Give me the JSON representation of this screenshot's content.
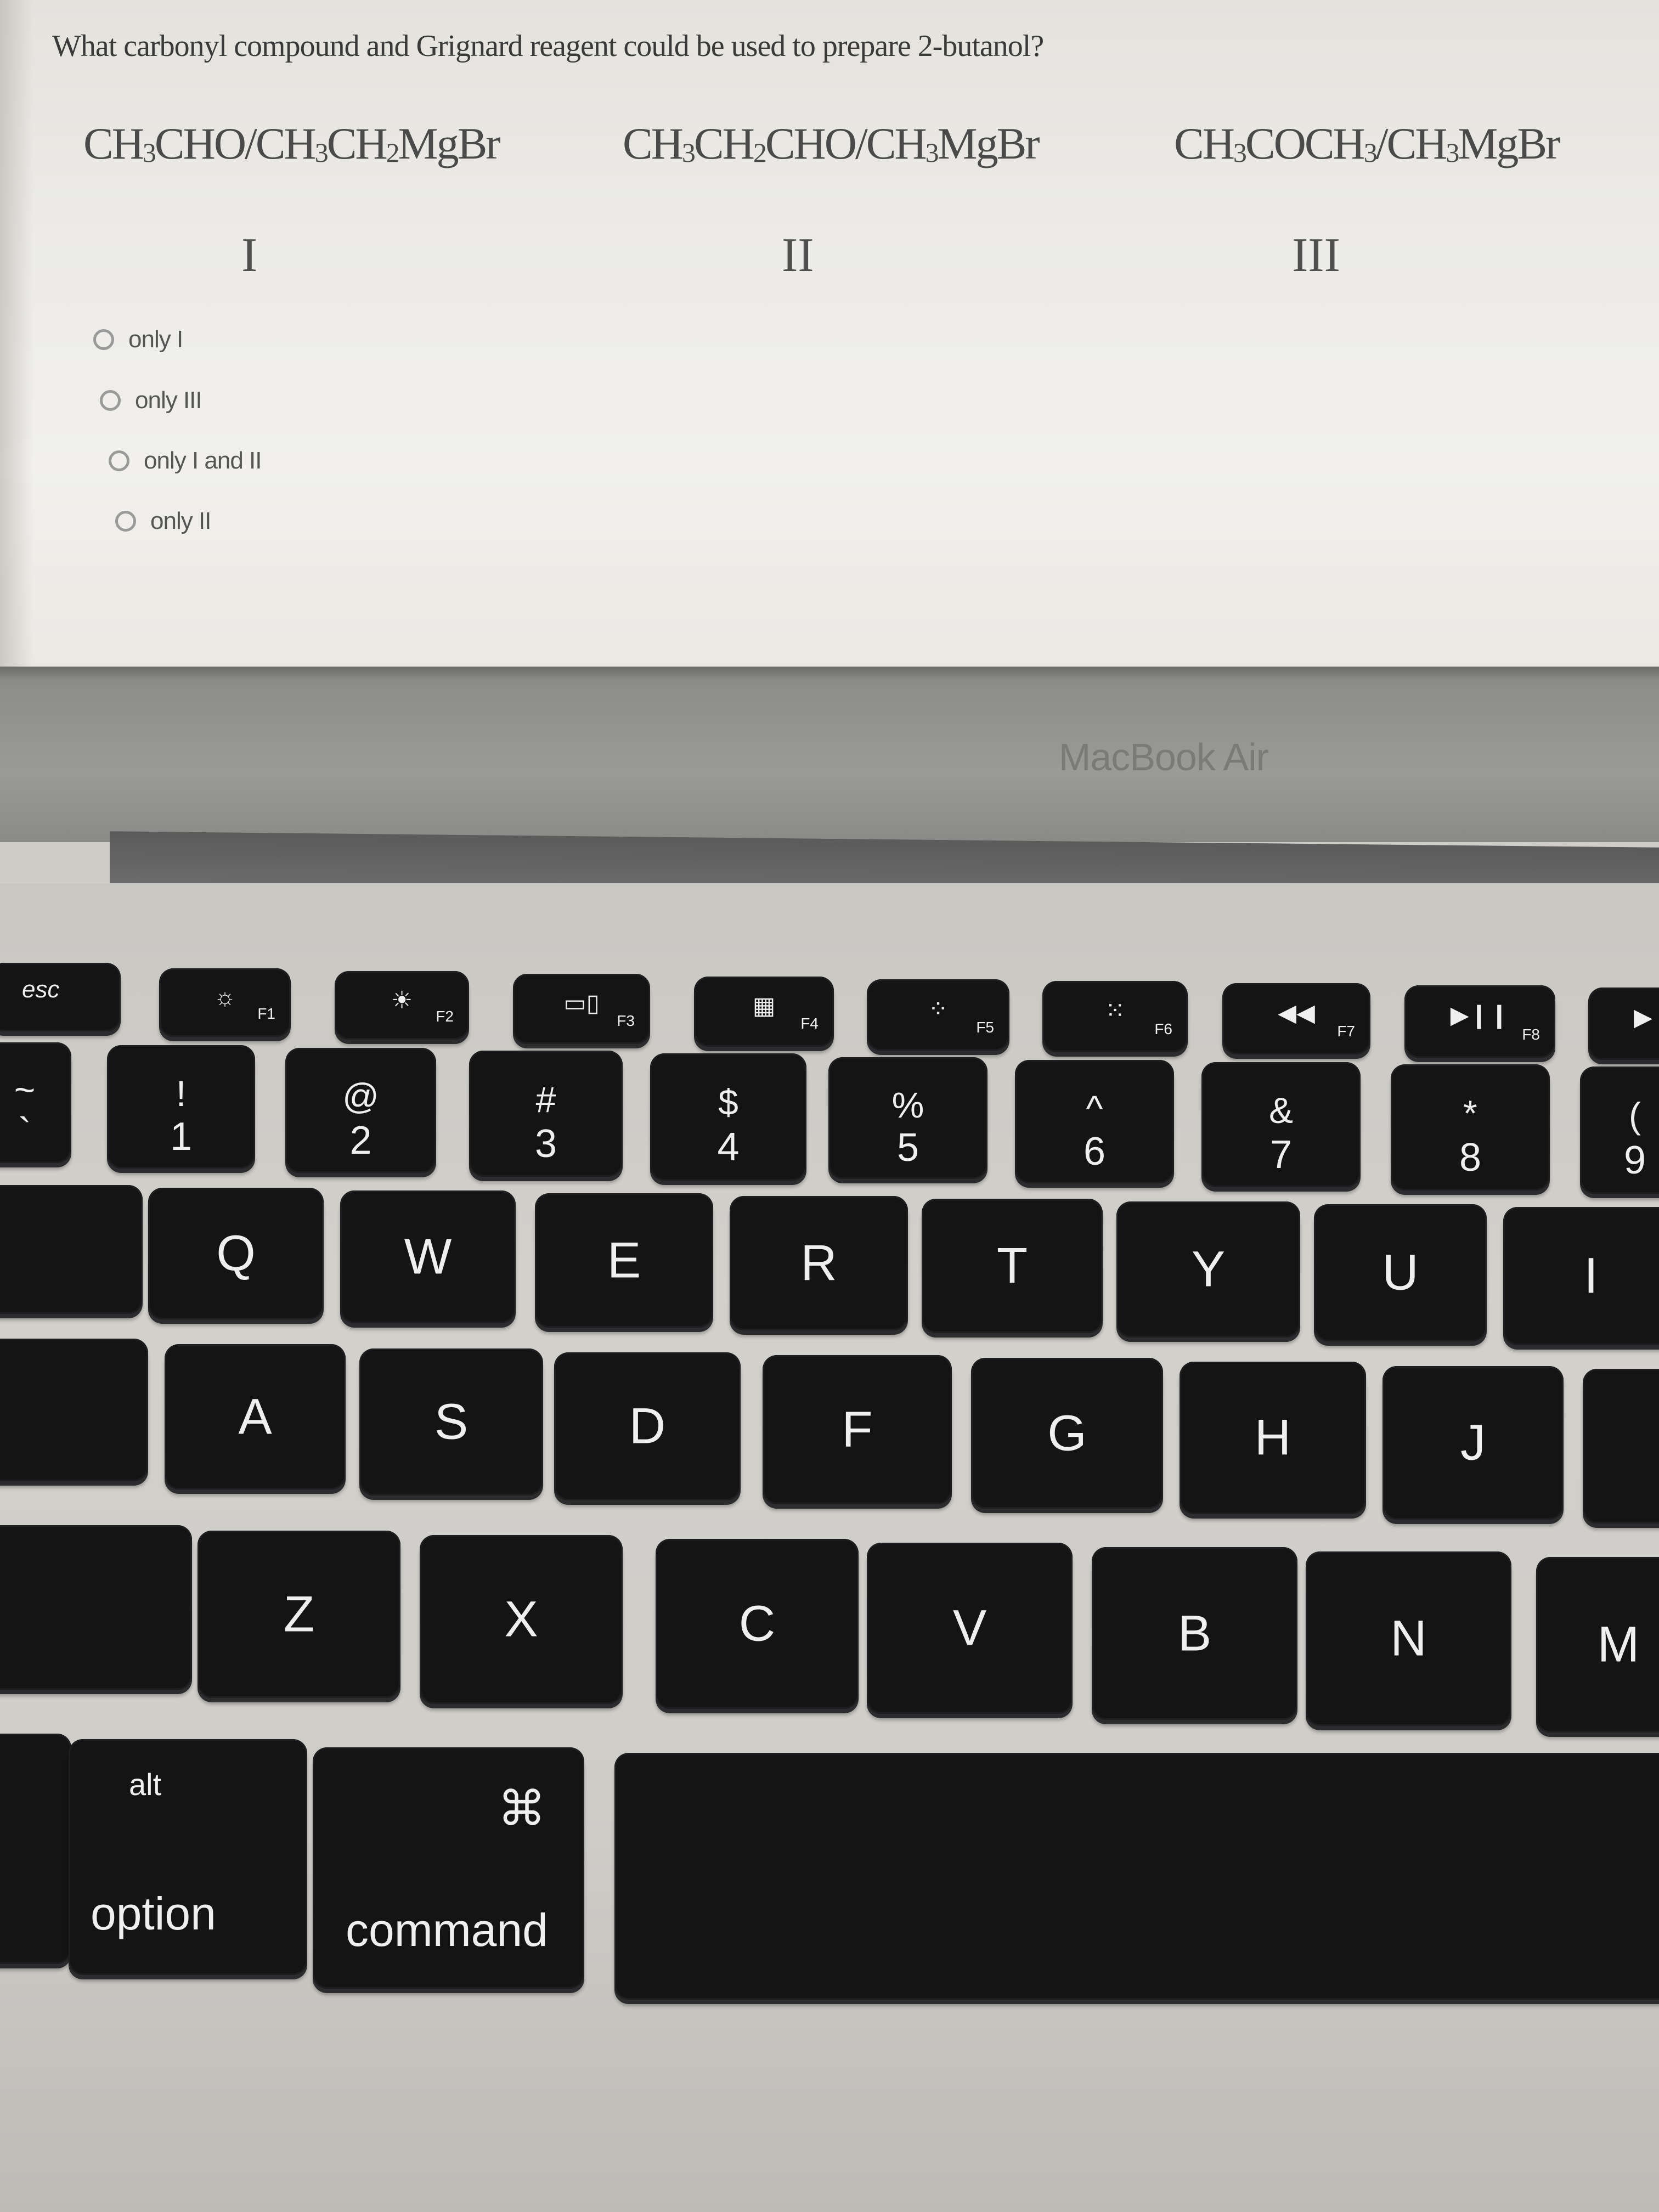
{
  "screen": {
    "question": "What carbonyl compound and Grignard reagent could be used to prepare 2-butanol?",
    "choices": [
      {
        "numeral": "I",
        "formula_parts": [
          "CH",
          "3",
          "CHO/CH",
          "3",
          "CH",
          "2",
          "MgBr"
        ]
      },
      {
        "numeral": "II",
        "formula_parts": [
          "CH",
          "3",
          "CH",
          "2",
          "CHO/CH",
          "3",
          "MgBr"
        ]
      },
      {
        "numeral": "III",
        "formula_parts": [
          "CH",
          "3",
          "COCH",
          "3",
          "/CH",
          "3",
          "MgBr"
        ]
      }
    ],
    "options": [
      {
        "label": "only I",
        "selected": false
      },
      {
        "label": "only III",
        "selected": false
      },
      {
        "label": "only I and II",
        "selected": false
      },
      {
        "label": "only II",
        "selected": false
      }
    ]
  },
  "device": {
    "brand": "MacBook Air"
  },
  "keyboard": {
    "function_row": [
      {
        "glyph": "",
        "fn": "",
        "label": "esc",
        "icon": "escape"
      },
      {
        "glyph": "☼",
        "fn": "F1",
        "icon": "brightness-down-icon"
      },
      {
        "glyph": "☀",
        "fn": "F2",
        "icon": "brightness-up-icon"
      },
      {
        "glyph": "▭▯",
        "fn": "F3",
        "icon": "mission-control-icon"
      },
      {
        "glyph": "▦",
        "fn": "F4",
        "icon": "launchpad-icon"
      },
      {
        "glyph": "⁘",
        "fn": "F5",
        "icon": "keyboard-light-down-icon"
      },
      {
        "glyph": "⁙",
        "fn": "F6",
        "icon": "keyboard-light-up-icon"
      },
      {
        "glyph": "◀◀",
        "fn": "F7",
        "icon": "rewind-icon"
      },
      {
        "glyph": "▶❙❙",
        "fn": "F8",
        "icon": "play-pause-icon"
      },
      {
        "glyph": "▶",
        "fn": "",
        "icon": "fast-forward-icon"
      }
    ],
    "number_row": [
      {
        "top": "~",
        "bottom": "`"
      },
      {
        "top": "!",
        "bottom": "1"
      },
      {
        "top": "@",
        "bottom": "2"
      },
      {
        "top": "#",
        "bottom": "3"
      },
      {
        "top": "$",
        "bottom": "4"
      },
      {
        "top": "%",
        "bottom": "5"
      },
      {
        "top": "^",
        "bottom": "6"
      },
      {
        "top": "&",
        "bottom": "7"
      },
      {
        "top": "*",
        "bottom": "8"
      },
      {
        "top": "(",
        "bottom": "9"
      }
    ],
    "qwerty_row": [
      "Q",
      "W",
      "E",
      "R",
      "T",
      "Y",
      "U",
      "I"
    ],
    "home_row": [
      "A",
      "S",
      "D",
      "F",
      "G",
      "H",
      "J"
    ],
    "bottom_row": [
      "Z",
      "X",
      "C",
      "V",
      "B",
      "N",
      "M"
    ],
    "modifiers": {
      "option_top": "alt",
      "option_bottom": "option",
      "command_symbol": "⌘",
      "command_label": "command"
    }
  }
}
